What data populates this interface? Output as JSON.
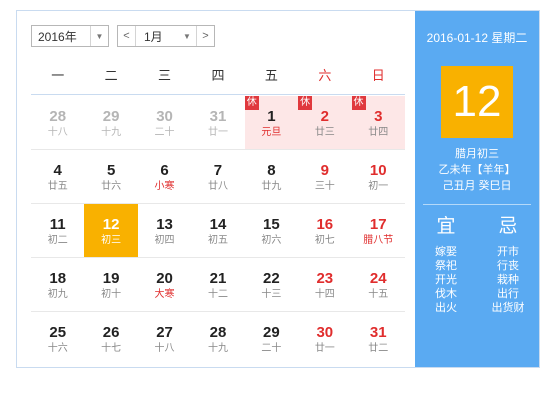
{
  "toolbar": {
    "year": "2016年",
    "month": "1月",
    "prev_symbol": "<",
    "next_symbol": ">",
    "dropdown_symbol": "▼"
  },
  "weekdays": [
    "一",
    "二",
    "三",
    "四",
    "五",
    "六",
    "日"
  ],
  "weeks": [
    [
      {
        "num": "28",
        "lunar": "十八",
        "other": true
      },
      {
        "num": "29",
        "lunar": "十九",
        "other": true
      },
      {
        "num": "30",
        "lunar": "二十",
        "other": true
      },
      {
        "num": "31",
        "lunar": "廿一",
        "other": true
      },
      {
        "num": "1",
        "lunar": "元旦",
        "rest": true,
        "festival": true
      },
      {
        "num": "2",
        "lunar": "廿三",
        "rest": true,
        "weekend": true
      },
      {
        "num": "3",
        "lunar": "廿四",
        "rest": true,
        "weekend": true
      }
    ],
    [
      {
        "num": "4",
        "lunar": "廿五"
      },
      {
        "num": "5",
        "lunar": "廿六"
      },
      {
        "num": "6",
        "lunar": "小寒",
        "festival": true
      },
      {
        "num": "7",
        "lunar": "廿八"
      },
      {
        "num": "8",
        "lunar": "廿九"
      },
      {
        "num": "9",
        "lunar": "三十",
        "weekend": true
      },
      {
        "num": "10",
        "lunar": "初一",
        "weekend": true
      }
    ],
    [
      {
        "num": "11",
        "lunar": "初二"
      },
      {
        "num": "12",
        "lunar": "初三",
        "today": true
      },
      {
        "num": "13",
        "lunar": "初四"
      },
      {
        "num": "14",
        "lunar": "初五"
      },
      {
        "num": "15",
        "lunar": "初六"
      },
      {
        "num": "16",
        "lunar": "初七",
        "weekend": true
      },
      {
        "num": "17",
        "lunar": "腊八节",
        "weekend": true,
        "festival": true
      }
    ],
    [
      {
        "num": "18",
        "lunar": "初九"
      },
      {
        "num": "19",
        "lunar": "初十"
      },
      {
        "num": "20",
        "lunar": "大寒",
        "festival": true
      },
      {
        "num": "21",
        "lunar": "十二"
      },
      {
        "num": "22",
        "lunar": "十三"
      },
      {
        "num": "23",
        "lunar": "十四",
        "weekend": true
      },
      {
        "num": "24",
        "lunar": "十五",
        "weekend": true
      }
    ],
    [
      {
        "num": "25",
        "lunar": "十六"
      },
      {
        "num": "26",
        "lunar": "十七"
      },
      {
        "num": "27",
        "lunar": "十八"
      },
      {
        "num": "28",
        "lunar": "十九"
      },
      {
        "num": "29",
        "lunar": "二十"
      },
      {
        "num": "30",
        "lunar": "廿一",
        "weekend": true
      },
      {
        "num": "31",
        "lunar": "廿二",
        "weekend": true
      }
    ]
  ],
  "rest_badge": "休",
  "side": {
    "date_line": "2016-01-12 星期二",
    "big_day": "12",
    "lunar_lines": [
      "腊月初三",
      "乙未年【羊年】",
      "己丑月 癸巳日"
    ],
    "yi_label": "宜",
    "ji_label": "忌",
    "yi_items": [
      "嫁娶",
      "祭祀",
      "开光",
      "伐木",
      "出火"
    ],
    "ji_items": [
      "开市",
      "行丧",
      "栽种",
      "出行",
      "出货财"
    ]
  },
  "colors": {
    "accent_blue": "#5aaaf2",
    "today_yellow": "#f9b100",
    "weekend_red": "#e02d2d",
    "rest_bg": "#fde7e7",
    "rest_badge": "#e0393e"
  }
}
